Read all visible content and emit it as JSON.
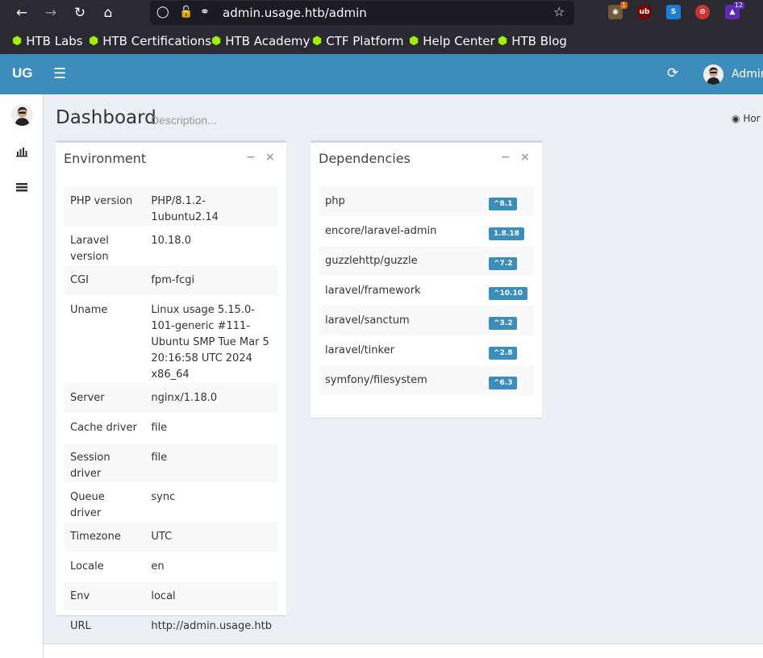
{
  "browser": {
    "url": "admin.usage.htb/admin",
    "ext_badges": {
      "first": "1",
      "last": "12"
    },
    "bookmarks": [
      "HTB Labs",
      "HTB Certifications",
      "HTB Academy",
      "CTF Platform",
      "Help Center",
      "HTB Blog"
    ]
  },
  "header": {
    "logo": "UG",
    "user": "Admin"
  },
  "page": {
    "title": "Dashboard",
    "description": "Description...",
    "breadcrumb": "Hor"
  },
  "environment": {
    "title": "Environment",
    "rows": [
      {
        "k": "PHP version",
        "v": "PHP/8.1.2-1ubuntu2.14"
      },
      {
        "k": "Laravel version",
        "v": "10.18.0"
      },
      {
        "k": "CGI",
        "v": "fpm-fcgi"
      },
      {
        "k": "Uname",
        "v": "Linux usage 5.15.0-101-generic #111-Ubuntu SMP Tue Mar 5 20:16:58 UTC 2024 x86_64"
      },
      {
        "k": "Server",
        "v": "nginx/1.18.0"
      },
      {
        "k": "Cache driver",
        "v": "file"
      },
      {
        "k": "Session driver",
        "v": "file"
      },
      {
        "k": "Queue driver",
        "v": "sync"
      },
      {
        "k": "Timezone",
        "v": "UTC"
      },
      {
        "k": "Locale",
        "v": "en"
      },
      {
        "k": "Env",
        "v": "local"
      },
      {
        "k": "URL",
        "v": "http://admin.usage.htb"
      }
    ]
  },
  "dependencies": {
    "title": "Dependencies",
    "rows": [
      {
        "k": "php",
        "v": "^8.1"
      },
      {
        "k": "encore/laravel-admin",
        "v": "1.8.18"
      },
      {
        "k": "guzzlehttp/guzzle",
        "v": "^7.2"
      },
      {
        "k": "laravel/framework",
        "v": "^10.10"
      },
      {
        "k": "laravel/sanctum",
        "v": "^3.2"
      },
      {
        "k": "laravel/tinker",
        "v": "^2.8"
      },
      {
        "k": "symfony/filesystem",
        "v": "^6.3"
      }
    ]
  },
  "colors": {
    "header": "#3c8dbc",
    "label": "#3c8dbc",
    "bookmark_icon": "#9fef00"
  }
}
